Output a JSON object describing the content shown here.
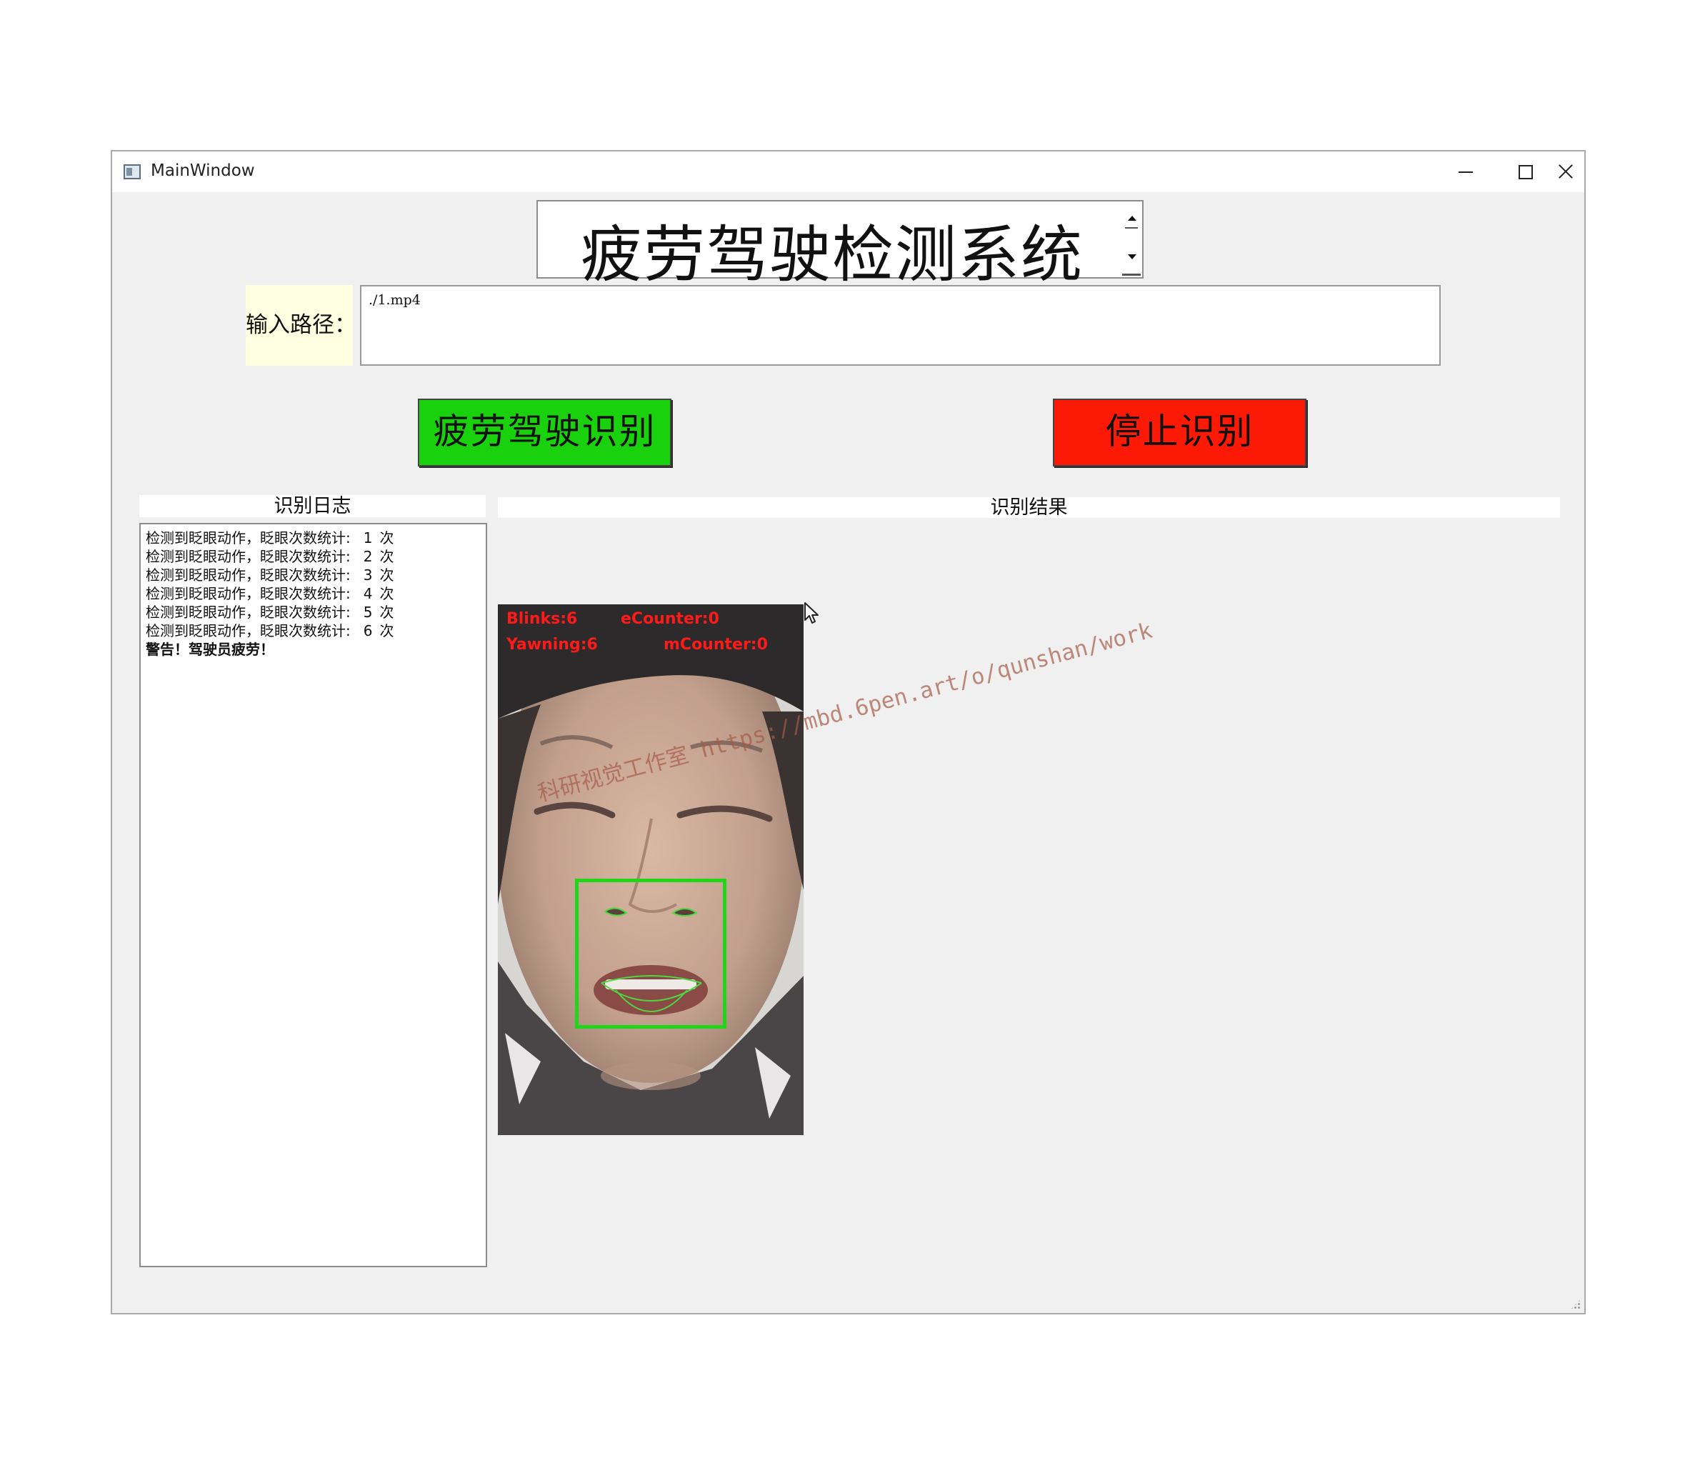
{
  "window": {
    "title": "MainWindow",
    "controls": {
      "minimize": "minimize",
      "maximize": "maximize",
      "close": "close"
    }
  },
  "heading": {
    "text": "疲劳驾驶检测系统"
  },
  "path": {
    "label": "输入路径：",
    "value": "./1.mp4"
  },
  "buttons": {
    "detect_label": "疲劳驾驶识别",
    "stop_label": "停止识别",
    "detect_color": "#1ad10d",
    "stop_color": "#fc1a06"
  },
  "log": {
    "header": "识别日志",
    "lines": [
      {
        "text": "检测到眨眼动作，眨眼次数统计:",
        "count": "1",
        "unit": "次"
      },
      {
        "text": "检测到眨眼动作，眨眼次数统计:",
        "count": "2",
        "unit": "次"
      },
      {
        "text": "检测到眨眼动作，眨眼次数统计:",
        "count": "3",
        "unit": "次"
      },
      {
        "text": "检测到眨眼动作，眨眼次数统计:",
        "count": "4",
        "unit": "次"
      },
      {
        "text": "检测到眨眼动作，眨眼次数统计:",
        "count": "5",
        "unit": "次"
      },
      {
        "text": "检测到眨眼动作，眨眼次数统计:",
        "count": "6",
        "unit": "次"
      }
    ],
    "warning": "警告！驾驶员疲劳！"
  },
  "result": {
    "header": "识别结果",
    "overlay": {
      "blinks": "Blinks:6",
      "ecounter": "eCounter:0",
      "yawning": "Yawning:6",
      "mcounter": "mCounter:0"
    }
  },
  "watermark": "科研视觉工作室 https://mbd.6pen.art/o/qunshan/work"
}
